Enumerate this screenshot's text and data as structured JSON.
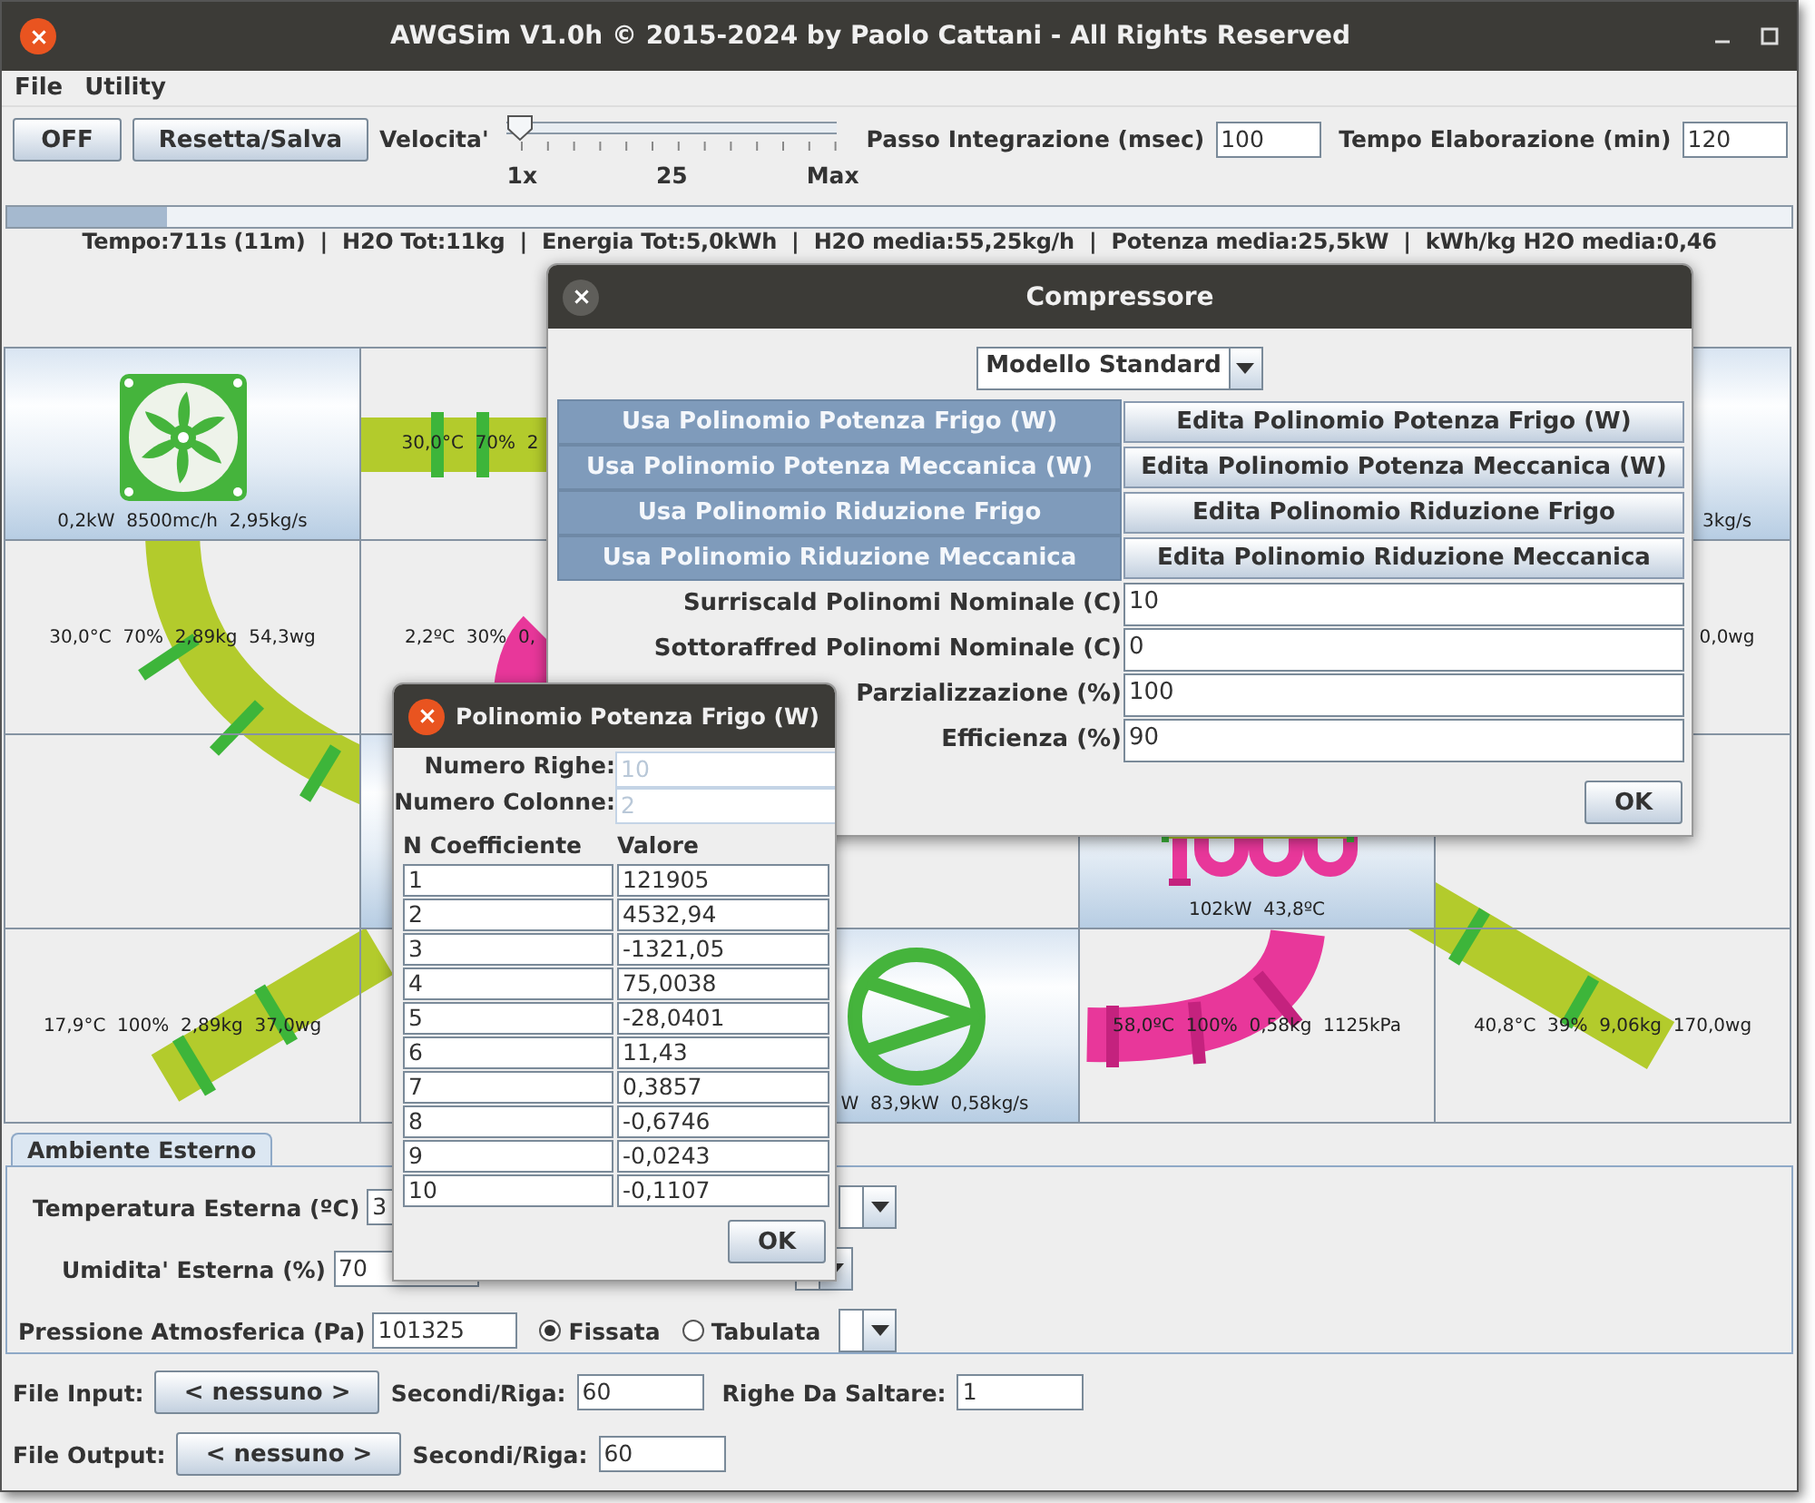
{
  "window": {
    "title": "AWGSim V1.0h © 2015-2024 by Paolo Cattani - All Rights Reserved"
  },
  "menu": [
    "File",
    "Utility"
  ],
  "toolbar": {
    "power_button": "OFF",
    "reset_button": "Resetta/Salva",
    "speed_label": "Velocita'",
    "speed_slider": {
      "level": 0,
      "ticks": [
        "1x",
        "25",
        "Max"
      ]
    },
    "step_label": "Passo Integrazione (msec)",
    "step_value": "100",
    "time_label": "Tempo Elaborazione (min)",
    "time_value": "120"
  },
  "progress": {
    "level": 0.09
  },
  "stats": "Tempo:711s (11m)  |  H2O Tot:11kg  |  Energia Tot:5,0kWh  |  H2O media:55,25kg/h  |  Potenza media:25,5kW  |  kWh/kg H2O media:0,46",
  "diagram": {
    "cells": [
      {
        "kind": "fan",
        "label": "0,2kW  8500mc/h  2,95kg/s"
      },
      {
        "kind": "plain",
        "label": "30,0°C  70%  2"
      },
      {
        "kind": "plain"
      },
      {
        "kind": "plain"
      },
      {
        "kind": "unit",
        "label": "3kg/s"
      },
      {
        "kind": "plain",
        "label": "30,0°C  70%  2,89kg  54,3wg"
      },
      {
        "kind": "plain",
        "label": "2,2ºC  30%  0,"
      },
      {
        "kind": "plain"
      },
      {
        "kind": "plain"
      },
      {
        "kind": "plain",
        "label": "0,0wg"
      },
      {
        "kind": "plain"
      },
      {
        "kind": "unit"
      },
      {
        "kind": "plain"
      },
      {
        "kind": "condenser",
        "label": "102kW  43,8ºC"
      },
      {
        "kind": "plain"
      },
      {
        "kind": "plain",
        "label": "17,9°C  100%  2,89kg  37,0wg"
      },
      {
        "kind": "plain"
      },
      {
        "kind": "compressor",
        "label": "W  83,9kW  0,58kg/s"
      },
      {
        "kind": "plain",
        "label": "58,0ºC  100%  0,58kg  1125kPa"
      },
      {
        "kind": "plain",
        "label": "40,8°C  39%  9,06kg  170,0wg"
      }
    ]
  },
  "ambient": {
    "tab": {
      "label": "Ambiente Esterno",
      "selected": true
    },
    "temperature": {
      "label": "Temperatura Esterna (ºC)",
      "value": "3"
    },
    "humidity": {
      "label": "Umidita' Esterna (%)",
      "value": "70"
    },
    "pressure": {
      "label": "Pressione Atmosferica (Pa)",
      "value": "101325",
      "modes": [
        {
          "label": "Fissata",
          "selected": true
        },
        {
          "label": "Tabulata",
          "selected": false
        }
      ]
    }
  },
  "files": [
    {
      "label": "File Input:",
      "button": "< nessuno >",
      "fields": [
        {
          "label": "Secondi/Riga:",
          "value": "60"
        },
        {
          "label": "Righe Da Saltare:",
          "value": "1"
        }
      ]
    },
    {
      "label": "File Output:",
      "button": "< nessuno >",
      "fields": [
        {
          "label": "Secondi/Riga:",
          "value": "60"
        }
      ]
    }
  ],
  "compressor_dialog": {
    "title": "Compressore",
    "model": "Modello Standard",
    "polynomials": [
      {
        "use": "Usa Polinomio Potenza Frigo (W)",
        "edit": "Edita Polinomio Potenza Frigo (W)",
        "disabled": true
      },
      {
        "use": "Usa Polinomio Potenza Meccanica (W)",
        "edit": "Edita Polinomio Potenza Meccanica (W)",
        "disabled": true
      },
      {
        "use": "Usa Polinomio Riduzione Frigo",
        "edit": "Edita Polinomio Riduzione Frigo",
        "disabled": true
      },
      {
        "use": "Usa Polinomio Riduzione Meccanica",
        "edit": "Edita Polinomio Riduzione Meccanica",
        "disabled": true
      }
    ],
    "params": [
      {
        "label": "Surriscald Polinomi Nominale (C)",
        "value": "10"
      },
      {
        "label": "Sottoraffred Polinomi Nominale (C)",
        "value": "0"
      },
      {
        "label": "Parzializzazione (%)",
        "value": "100"
      },
      {
        "label": "Efficienza (%)",
        "value": "90"
      }
    ],
    "ok": "OK"
  },
  "polynomial_dialog": {
    "title": "Polinomio Potenza Frigo (W)",
    "rows_label": "Numero Righe:",
    "rows_value": "10",
    "cols_label": "Numero Colonne:",
    "cols_value": "2",
    "size_disabled": true,
    "headers": [
      "N Coefficiente",
      "Valore"
    ],
    "coefficients": [
      [
        "1",
        "121905"
      ],
      [
        "2",
        "4532,94"
      ],
      [
        "3",
        "-1321,05"
      ],
      [
        "4",
        "75,0038"
      ],
      [
        "5",
        "-28,0401"
      ],
      [
        "6",
        "11,43"
      ],
      [
        "7",
        "0,3857"
      ],
      [
        "8",
        "-0,6746"
      ],
      [
        "9",
        "-0,0243"
      ],
      [
        "10",
        "-0,1107"
      ]
    ],
    "ok": "OK"
  }
}
